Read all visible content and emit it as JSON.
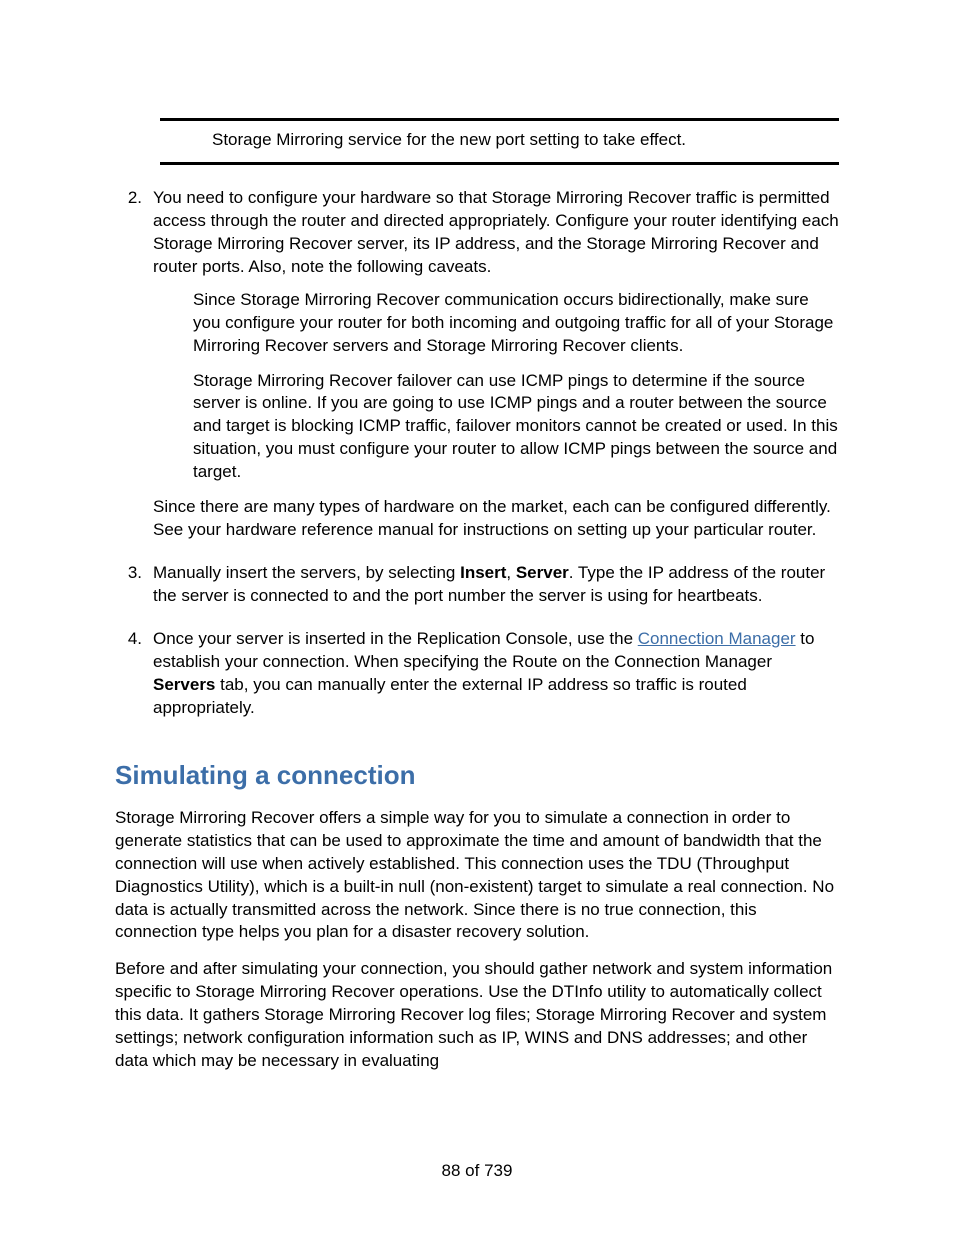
{
  "boxed_note": "Storage Mirroring service for the new port setting to take effect.",
  "items": {
    "i2": {
      "marker": "2.",
      "p1": "You need to configure your hardware so that Storage Mirroring Recover traffic is permitted access through the router and directed appropriately. Configure your router identifying each Storage Mirroring Recover server, its IP address, and the Storage Mirroring Recover and router ports. Also, note the following caveats.",
      "sub1": "Since Storage Mirroring Recover communication occurs bidirectionally, make sure you configure your router for both incoming and outgoing traffic for all of your Storage Mirroring Recover servers and Storage Mirroring Recover clients.",
      "sub2": "Storage Mirroring Recover failover can use ICMP pings to determine if the source server is online. If you are going to use ICMP pings and a router between the source and target is blocking ICMP traffic, failover monitors cannot be created or used. In this situation, you must configure your router to allow ICMP pings between the source and target.",
      "p2": "Since there are many types of hardware on the market, each can be configured differently. See your hardware reference manual for instructions on setting up your particular router."
    },
    "i3": {
      "marker": "3.",
      "pre": "Manually insert the servers, by selecting ",
      "b1": "Insert",
      "mid": ", ",
      "b2": "Server",
      "post": ". Type the IP address of the router the server is connected to and the port number the server is using for heartbeats."
    },
    "i4": {
      "marker": "4.",
      "pre": "Once your server is inserted in the Replication Console, use the ",
      "link": "Connection Manager",
      "mid": " to establish your connection. When specifying the Route on the Connection Manager ",
      "b1": "Servers",
      "post": " tab, you can manually enter the external IP address so traffic is routed appropriately."
    }
  },
  "section_heading": "Simulating a connection",
  "sim_p1": "Storage Mirroring Recover offers a simple way for you to simulate a connection in order to generate statistics that can be used to approximate the time and amount of bandwidth that the connection will use when actively established. This connection uses the TDU (Throughput Diagnostics Utility), which is a built-in null (non-existent) target to simulate a real connection. No data is actually transmitted across the network. Since there is no true connection, this connection type helps you plan for a disaster recovery solution.",
  "sim_p2": "Before and after simulating your connection, you should gather network and system information specific to Storage Mirroring Recover operations. Use the DTInfo utility to automatically collect this data. It gathers Storage Mirroring Recover log files; Storage Mirroring Recover and system settings; network configuration information such as IP, WINS and DNS addresses; and other data which may be necessary in evaluating",
  "page_number": "88 of 739"
}
